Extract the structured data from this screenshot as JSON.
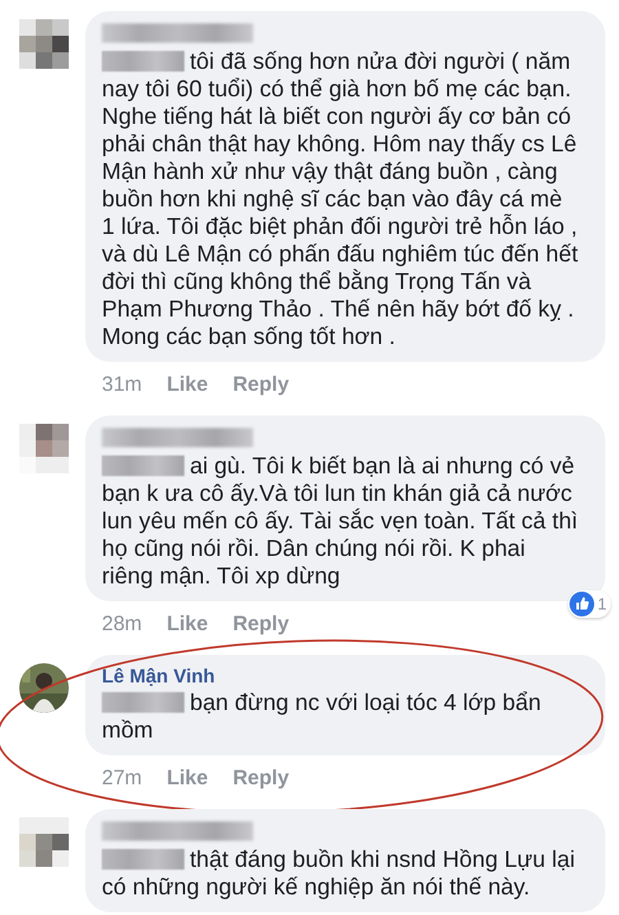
{
  "comments": [
    {
      "author_blurred": true,
      "mention_blurred": true,
      "text": "tôi đã sống hơn nửa đời người ( năm nay tôi 60 tuổi) có thể già hơn bố mẹ các bạn. Nghe tiếng hát là biết con người ấy cơ bản có phải chân thật hay không. Hôm nay thấy cs Lê Mận hành xử như vậy thật đáng buồn , càng buồn hơn khi nghệ sĩ các bạn vào đây cá mè 1 lứa. Tôi đặc biệt phản đối người trẻ hỗn láo , và dù Lê Mận có phấn đấu nghiêm túc đến hết đời thì cũng không thể bằng Trọng Tấn và Phạm Phương Thảo . Thế nên hãy bớt đố kỵ . Mong các bạn sống tốt hơn .",
      "time": "31m",
      "actions": [
        "Like",
        "Reply"
      ],
      "highlighted": false
    },
    {
      "author_blurred": true,
      "mention_blurred": true,
      "text": "ai gù. Tôi k biết bạn là ai nhưng có vẻ bạn k ưa cô ấy.Và tôi lun tin khán giả cả nước lun yêu mến cô ấy. Tài sắc vẹn toàn. Tất cả thì họ cũng nói rồi. Dân chúng nói rồi. K phai riêng mận. Tôi xp dừng",
      "time": "28m",
      "actions": [
        "Like",
        "Reply"
      ],
      "reaction_count": "1",
      "highlighted": false
    },
    {
      "author": "Lê Mận Vinh",
      "author_blurred": false,
      "mention_blurred": true,
      "text": "bạn đừng nc với loại tóc 4 lớp bẩn mồm",
      "time": "27m",
      "actions": [
        "Like",
        "Reply"
      ],
      "highlighted": true
    },
    {
      "author_blurred": true,
      "mention_blurred": true,
      "text": "thật đáng buồn khi nsnd Hồng Lựu lại có những người kế nghiệp ăn nói thế này.",
      "highlighted": false
    }
  ]
}
